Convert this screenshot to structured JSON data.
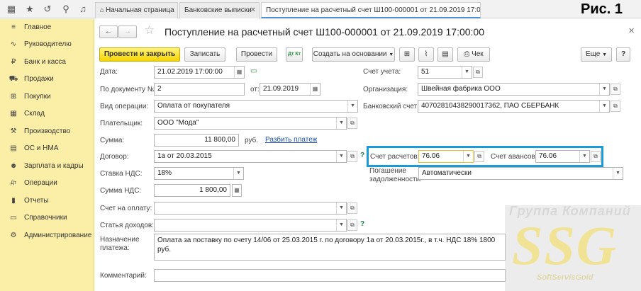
{
  "header": {
    "tabs": [
      {
        "label": "Начальная страница"
      },
      {
        "label": "Банковские выписки"
      },
      {
        "label": "Поступление на расчетный счет Ш100-000001 от 21.09.2019 17:00:00"
      }
    ],
    "figure_label": "Рис. 1"
  },
  "sidebar": {
    "items": [
      {
        "label": "Главное",
        "icon": "≡"
      },
      {
        "label": "Руководителю",
        "icon": "∿"
      },
      {
        "label": "Банк и касса",
        "icon": "₽"
      },
      {
        "label": "Продажи",
        "icon": "⛟"
      },
      {
        "label": "Покупки",
        "icon": "⊞"
      },
      {
        "label": "Склад",
        "icon": "▦"
      },
      {
        "label": "Производство",
        "icon": "⚒"
      },
      {
        "label": "ОС и НМА",
        "icon": "▤"
      },
      {
        "label": "Зарплата и кадры",
        "icon": "☻"
      },
      {
        "label": "Операции",
        "icon": "Дт"
      },
      {
        "label": "Отчеты",
        "icon": "▮"
      },
      {
        "label": "Справочники",
        "icon": "▭"
      },
      {
        "label": "Администрирование",
        "icon": "⚙"
      }
    ]
  },
  "document": {
    "title": "Поступление на расчетный счет Ш100-000001 от 21.09.2019 17:00:00"
  },
  "toolbar": {
    "post_close": "Провести и закрыть",
    "save": "Записать",
    "post": "Провести",
    "dtkt": "Дт Кт",
    "create_based": "Создать на основании",
    "check": "Чек",
    "more": "Еще",
    "help": "?"
  },
  "form": {
    "date_label": "Дата:",
    "date_value": "21.02.2019 17:00:00",
    "doc_no_label": "По документу №:",
    "doc_no_value": "2",
    "from_label": "от:",
    "from_value": "21.09.2019",
    "op_type_label": "Вид операции:",
    "op_type_value": "Оплата от покупателя",
    "payer_label": "Плательщик:",
    "payer_value": "ООО \"Мода\"",
    "sum_label": "Сумма:",
    "sum_value": "11 800,00",
    "sum_unit": "руб.",
    "split_link": "Разбить платеж",
    "contract_label": "Договор:",
    "contract_value": "1а от 20.03.2015",
    "vat_rate_label": "Ставка НДС:",
    "vat_rate_value": "18%",
    "vat_sum_label": "Сумма НДС:",
    "vat_sum_value": "1 800,00",
    "invoice_label": "Счет на оплату:",
    "invoice_value": "",
    "income_label": "Статья доходов:",
    "income_value": "",
    "purpose_label": "Назначение",
    "purpose_label2": "платежа:",
    "purpose_value": "Оплата за поставку по счету 14/06 от 25.03.2015 г. по договору 1а от 20.03.2015г., в т.ч. НДС 18% 1800 руб.",
    "comment_label": "Комментарий:",
    "comment_value": "",
    "account_label": "Счет учета:",
    "account_value": "51",
    "org_label": "Организация:",
    "org_value": "Швейная фабрика ООО",
    "bank_label": "Банковский счет:",
    "bank_value": "40702810438290017362, ПАО СБЕРБАНК",
    "settle_label": "Счет расчетов:",
    "settle_value": "76.06",
    "advance_label": "Счет авансов:",
    "advance_value": "76.06",
    "debt_label": "Погашение",
    "debt_label2": "задолженности:",
    "debt_value": "Автоматически"
  },
  "watermark": {
    "line1": "Группа Компаний",
    "line2": "SSG",
    "line3": "SoftServisGold"
  },
  "colors": {
    "sidebar_bg": "#fbeea6",
    "primary_button": "#f4d400",
    "highlight_frame": "#1b9ad8",
    "link": "#1a4fa5"
  }
}
